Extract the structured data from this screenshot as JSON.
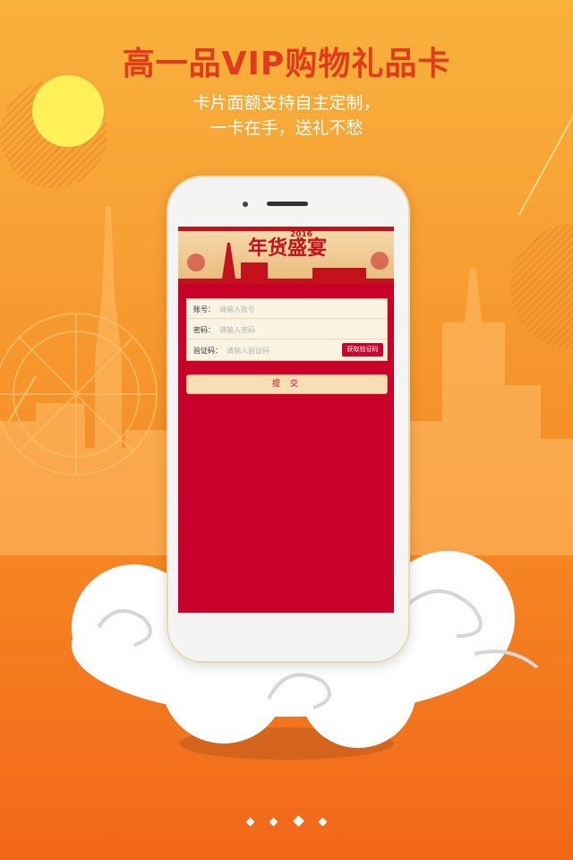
{
  "header": {
    "title": "高一品VIP购物礼品卡",
    "subtitle_line1": "卡片面额支持自主定制，",
    "subtitle_line2": "一卡在手，送礼不愁"
  },
  "banner": {
    "year": "2016",
    "title": "年货盛宴"
  },
  "form": {
    "account_label": "账号：",
    "account_placeholder": "请输入账号",
    "password_label": "密码：",
    "password_placeholder": "请输入密码",
    "code_label": "验证码：",
    "code_placeholder": "请输入验证码",
    "get_code_button": "获取验证码",
    "submit_button": "提 交"
  },
  "pagination": {
    "count": 4,
    "active_index": 2
  },
  "colors": {
    "title_red": "#e23a1c",
    "screen_red": "#c8002a",
    "sun_yellow": "#ffef58",
    "bg_orange": "#f7a034"
  }
}
